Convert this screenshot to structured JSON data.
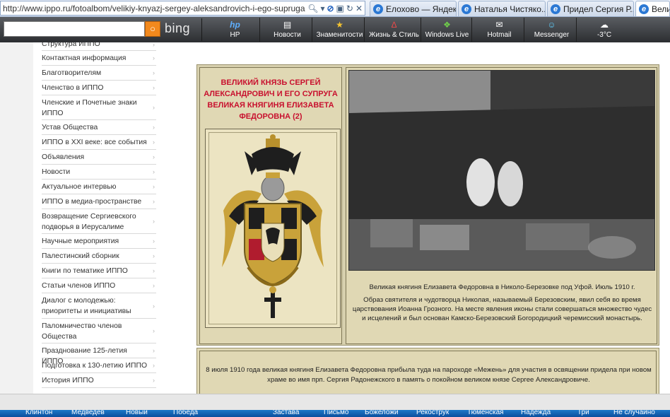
{
  "address_bar": {
    "url": "http://www.ippo.ru/fotoalbom/velikiy-knyazj-sergey-aleksandrovich-i-ego-supruga"
  },
  "tabs": [
    {
      "label": "Елохово — Яндек..."
    },
    {
      "label": "Наталья Чистяко..."
    },
    {
      "label": "Придел Сергия Р..."
    },
    {
      "label": "Велик"
    }
  ],
  "bing_toolbar": {
    "logo": "bing",
    "items": [
      {
        "icon": "hp-icon",
        "label": "HP"
      },
      {
        "icon": "news-icon",
        "label": "Новости"
      },
      {
        "icon": "star-icon",
        "label": "Знаменитости"
      },
      {
        "icon": "lifestyle-icon",
        "label": "Жизнь & Стиль"
      },
      {
        "icon": "windows-icon",
        "label": "Windows Live"
      },
      {
        "icon": "mail-icon",
        "label": "Hotmail"
      },
      {
        "icon": "messenger-icon",
        "label": "Messenger"
      },
      {
        "icon": "weather-icon",
        "label": "-3°C"
      }
    ]
  },
  "sidebar": {
    "items": [
      {
        "label": "Структура ИППО"
      },
      {
        "label": "Контактная информация"
      },
      {
        "label": "Благотворителям"
      },
      {
        "label": "Членство в ИППО"
      },
      {
        "label": "Членские и Почетные знаки ИППО"
      },
      {
        "label": "Устав Общества"
      },
      {
        "label": "ИППО в XXI веке: все события"
      },
      {
        "label": "Объявления"
      },
      {
        "label": "Новости"
      },
      {
        "label": "Актуальное интервью"
      },
      {
        "label": "ИППО в медиа-пространстве"
      },
      {
        "label": "Возвращение Сергиевского подворья в Иерусалиме"
      },
      {
        "label": "Научные мероприятия"
      },
      {
        "label": "Палестинский сборник"
      },
      {
        "label": "Книги по тематике ИППО"
      },
      {
        "label": "Статьи членов ИППО"
      },
      {
        "label": "Диалог с молодежью: приоритеты и инициативы"
      },
      {
        "label": "Паломничество членов Общества"
      },
      {
        "label": "Празднование 125-летия ИППО"
      },
      {
        "label": "Подготовка к 130-летию ИППО"
      },
      {
        "label": "История ИППО"
      }
    ]
  },
  "content": {
    "title": "ВЕЛИКИЙ КНЯЗЬ СЕРГЕЙ АЛЕКСАНДРОВИЧ И ЕГО СУПРУГА ВЕЛИКАЯ КНЯГИНЯ ЕЛИЗАВЕТА ФЕДОРОВНА (2)",
    "caption_title": "Великая княгиня Елизавета Федоровна в Николо-Березовке под Уфой. Июль 1910 г.",
    "caption_body": "Образ святителя и чудотворца Николая, называемый Березовским, явил себя во время царствования Иоанна Грозного. На месте явления иконы стали совершаться множество чудес и исцелений и был основан Камско-Березовский Богородицкий черемисский монастырь.",
    "bottom_text": "8 июля 1910 года великая княгиня Елизавета Федоровна прибыла туда на пароходе «Межень» для участия в освящении придела при новом храме во имя прп. Сергия Радонежского в память о покойном великом князе Сергее Александровиче."
  },
  "taskbar": {
    "items": [
      {
        "label": "Клинтон"
      },
      {
        "label": "Медведев"
      },
      {
        "label": "Новый"
      },
      {
        "label": "Победа"
      },
      {
        "label": "Застава"
      },
      {
        "label": "Письмо"
      },
      {
        "label": "Божеложи"
      },
      {
        "label": "Рекострук"
      },
      {
        "label": "Тюменская"
      },
      {
        "label": "Надежда"
      },
      {
        "label": "Три"
      },
      {
        "label": "Не случайно"
      }
    ]
  },
  "colors": {
    "title_red": "#c8102e",
    "frame_tan": "#e0d8b4",
    "toolbar_dark": "#2c2e31",
    "taskbar_blue": "#1d78c8"
  }
}
